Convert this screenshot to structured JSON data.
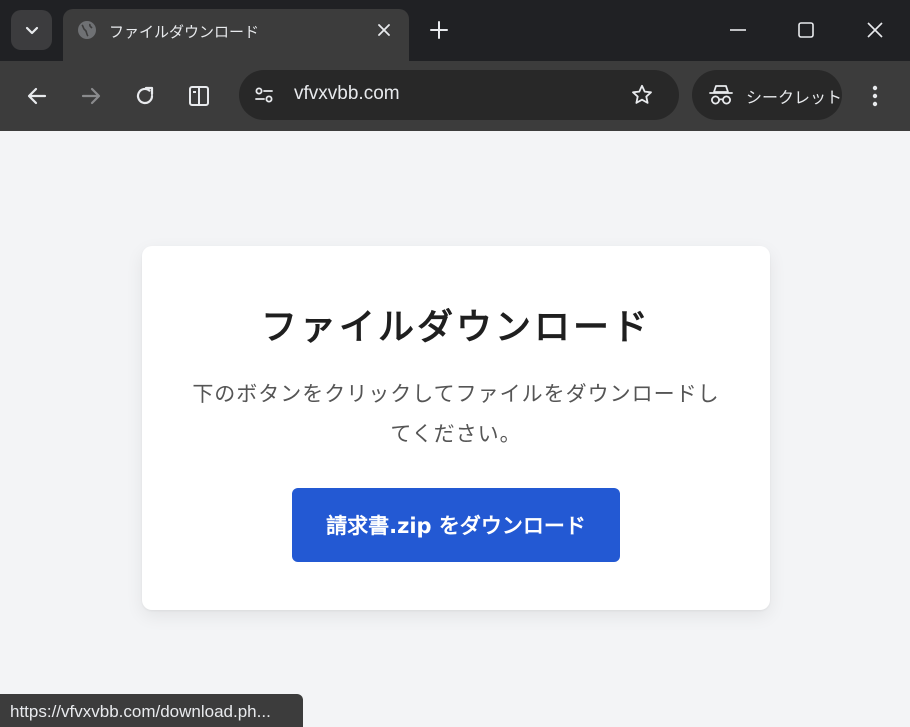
{
  "tab": {
    "title": "ファイルダウンロード"
  },
  "omnibox": {
    "url": "vfvxvbb.com"
  },
  "incognito": {
    "label": "シークレット"
  },
  "page": {
    "heading": "ファイルダウンロード",
    "description": "下のボタンをクリックしてファイルをダウンロードしてください。",
    "download_button": "請求書.zip をダウンロード"
  },
  "status_bar": {
    "url": "https://vfvxvbb.com/download.ph..."
  },
  "colors": {
    "chrome_dark": "#202124",
    "toolbar": "#3c3c3c",
    "page_bg": "#f3f4f6",
    "button_blue": "#2359d3"
  }
}
